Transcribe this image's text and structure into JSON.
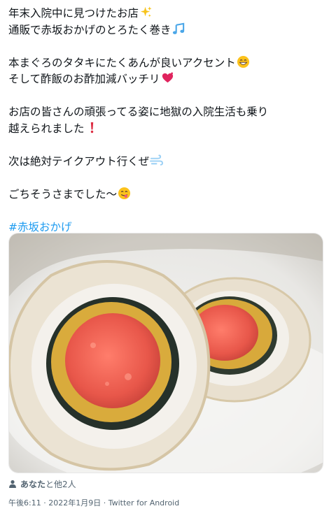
{
  "tweet": {
    "lines": [
      "年末入院中に見つけたお店",
      "通販で赤坂おかげのとろたく巻き",
      "本まぐろのタタキにたくあんが良いアクセント",
      "そして酢飯のお酢加減バッチリ",
      "お店の皆さんの頑張ってる姿に地獄の入院生活も乗り",
      "越えられました",
      "次は絶対テイクアウト行くぜ",
      "ごちそうさまでした〜"
    ],
    "hashtag": "#赤坂おかげ",
    "emojis": [
      "sparkles-icon",
      "music-note-icon",
      "grinning-face-icon",
      "heart-icon",
      "exclamation-icon",
      "dash-icon",
      "yum-face-icon"
    ]
  },
  "likes": {
    "who": "あなた",
    "rest": "と他2人"
  },
  "meta": {
    "time": "午後6:11",
    "sep1": " · ",
    "date": "2022年1月9日",
    "sep2": " · ",
    "source": "Twitter for Android"
  },
  "colors": {
    "link": "#1d9bf0",
    "secondary": "#536471"
  }
}
